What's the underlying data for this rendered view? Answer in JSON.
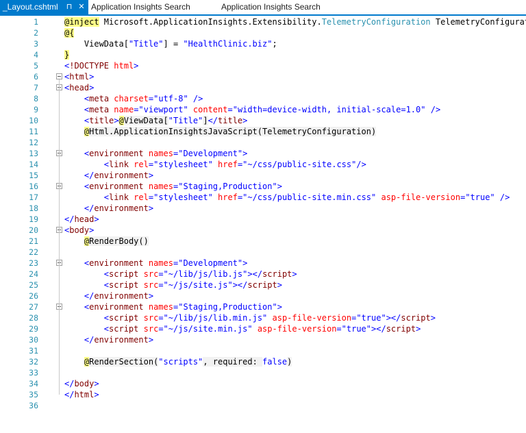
{
  "tabs": [
    {
      "label": "_Layout.cshtml",
      "active": true,
      "pin_glyph": "⊓",
      "close_glyph": "✕"
    },
    {
      "label": "Application Insights Search",
      "active": false
    },
    {
      "label": "Application Insights Search",
      "active": false
    }
  ],
  "colors": {
    "accent": "#007acc",
    "line_number": "#2b91af",
    "html_tag": "#800000",
    "html_attr": "#ff0000",
    "html_value": "#0000ff",
    "razor_highlight": "#ffff88"
  },
  "lines": [
    {
      "n": "1",
      "fold": false,
      "t": [
        [
          "razor",
          "@inject"
        ],
        [
          "txt",
          " Microsoft.ApplicationInsights.Extensibility."
        ],
        [
          "type",
          "TelemetryConfiguration"
        ],
        [
          "txt",
          " TelemetryConfiguration"
        ]
      ]
    },
    {
      "n": "2",
      "fold": false,
      "t": [
        [
          "razor",
          "@{"
        ]
      ]
    },
    {
      "n": "3",
      "fold": false,
      "t": [
        [
          "txt",
          "    ViewData["
        ],
        [
          "str",
          "\"Title\""
        ],
        [
          "txt",
          "] = "
        ],
        [
          "str",
          "\"HealthClinic.biz\""
        ],
        [
          "txt",
          ";"
        ]
      ]
    },
    {
      "n": "4",
      "fold": false,
      "t": [
        [
          "razor",
          "}"
        ]
      ]
    },
    {
      "n": "5",
      "fold": false,
      "t": [
        [
          "del",
          "<"
        ],
        [
          "tag",
          "!DOCTYPE"
        ],
        [
          "txt",
          " "
        ],
        [
          "attr",
          "html"
        ],
        [
          "del",
          ">"
        ]
      ]
    },
    {
      "n": "6",
      "fold": true,
      "t": [
        [
          "del",
          "<"
        ],
        [
          "tag",
          "html"
        ],
        [
          "del",
          ">"
        ]
      ]
    },
    {
      "n": "7",
      "fold": true,
      "t": [
        [
          "del",
          "<"
        ],
        [
          "tag",
          "head"
        ],
        [
          "del",
          ">"
        ]
      ]
    },
    {
      "n": "8",
      "fold": false,
      "t": [
        [
          "txt",
          "    "
        ],
        [
          "del",
          "<"
        ],
        [
          "tag",
          "meta"
        ],
        [
          "txt",
          " "
        ],
        [
          "attr",
          "charset"
        ],
        [
          "del",
          "="
        ],
        [
          "str",
          "\"utf-8\""
        ],
        [
          "txt",
          " "
        ],
        [
          "del",
          "/>"
        ]
      ]
    },
    {
      "n": "9",
      "fold": false,
      "t": [
        [
          "txt",
          "    "
        ],
        [
          "del",
          "<"
        ],
        [
          "tag",
          "meta"
        ],
        [
          "txt",
          " "
        ],
        [
          "attr",
          "name"
        ],
        [
          "del",
          "="
        ],
        [
          "str",
          "\"viewport\""
        ],
        [
          "txt",
          " "
        ],
        [
          "attr",
          "content"
        ],
        [
          "del",
          "="
        ],
        [
          "str",
          "\"width=device-width, initial-scale=1.0\""
        ],
        [
          "txt",
          " "
        ],
        [
          "del",
          "/>"
        ]
      ]
    },
    {
      "n": "10",
      "fold": false,
      "t": [
        [
          "txt",
          "    "
        ],
        [
          "del",
          "<"
        ],
        [
          "tag",
          "title"
        ],
        [
          "del",
          ">"
        ],
        [
          "razor",
          "@"
        ],
        [
          "raz-body",
          "ViewData["
        ],
        [
          "str",
          "\"Title\""
        ],
        [
          "raz-body",
          "]"
        ],
        [
          "del",
          "</"
        ],
        [
          "tag",
          "title"
        ],
        [
          "del",
          ">"
        ]
      ]
    },
    {
      "n": "11",
      "fold": false,
      "t": [
        [
          "txt",
          "    "
        ],
        [
          "razor",
          "@"
        ],
        [
          "raz-body",
          "Html.ApplicationInsightsJavaScript(TelemetryConfiguration)"
        ]
      ]
    },
    {
      "n": "12",
      "fold": false,
      "t": []
    },
    {
      "n": "13",
      "fold": true,
      "t": [
        [
          "txt",
          "    "
        ],
        [
          "del",
          "<"
        ],
        [
          "tag",
          "environment"
        ],
        [
          "txt",
          " "
        ],
        [
          "attr",
          "names"
        ],
        [
          "del",
          "="
        ],
        [
          "str",
          "\"Development\""
        ],
        [
          "del",
          ">"
        ]
      ]
    },
    {
      "n": "14",
      "fold": false,
      "t": [
        [
          "txt",
          "        "
        ],
        [
          "del",
          "<"
        ],
        [
          "tag",
          "link"
        ],
        [
          "txt",
          " "
        ],
        [
          "attr",
          "rel"
        ],
        [
          "del",
          "="
        ],
        [
          "str",
          "\"stylesheet\""
        ],
        [
          "txt",
          " "
        ],
        [
          "attr",
          "href"
        ],
        [
          "del",
          "="
        ],
        [
          "str",
          "\"~/css/public-site.css\""
        ],
        [
          "del",
          "/>"
        ]
      ]
    },
    {
      "n": "15",
      "fold": false,
      "t": [
        [
          "txt",
          "    "
        ],
        [
          "del",
          "</"
        ],
        [
          "tag",
          "environment"
        ],
        [
          "del",
          ">"
        ]
      ]
    },
    {
      "n": "16",
      "fold": true,
      "t": [
        [
          "txt",
          "    "
        ],
        [
          "del",
          "<"
        ],
        [
          "tag",
          "environment"
        ],
        [
          "txt",
          " "
        ],
        [
          "attr",
          "names"
        ],
        [
          "del",
          "="
        ],
        [
          "str",
          "\"Staging,Production\""
        ],
        [
          "del",
          ">"
        ]
      ]
    },
    {
      "n": "17",
      "fold": false,
      "t": [
        [
          "txt",
          "        "
        ],
        [
          "del",
          "<"
        ],
        [
          "tag",
          "link"
        ],
        [
          "txt",
          " "
        ],
        [
          "attr",
          "rel"
        ],
        [
          "del",
          "="
        ],
        [
          "str",
          "\"stylesheet\""
        ],
        [
          "txt",
          " "
        ],
        [
          "attr",
          "href"
        ],
        [
          "del",
          "="
        ],
        [
          "str",
          "\"~/css/public-site.min.css\""
        ],
        [
          "txt",
          " "
        ],
        [
          "attr",
          "asp-file-version"
        ],
        [
          "del",
          "="
        ],
        [
          "str",
          "\"true\""
        ],
        [
          "txt",
          " "
        ],
        [
          "del",
          "/>"
        ]
      ]
    },
    {
      "n": "18",
      "fold": false,
      "t": [
        [
          "txt",
          "    "
        ],
        [
          "del",
          "</"
        ],
        [
          "tag",
          "environment"
        ],
        [
          "del",
          ">"
        ]
      ]
    },
    {
      "n": "19",
      "fold": false,
      "t": [
        [
          "del",
          "</"
        ],
        [
          "tag",
          "head"
        ],
        [
          "del",
          ">"
        ]
      ]
    },
    {
      "n": "20",
      "fold": true,
      "t": [
        [
          "del",
          "<"
        ],
        [
          "tag",
          "body"
        ],
        [
          "del",
          ">"
        ]
      ]
    },
    {
      "n": "21",
      "fold": false,
      "t": [
        [
          "txt",
          "    "
        ],
        [
          "razor",
          "@"
        ],
        [
          "raz-body",
          "RenderBody()"
        ]
      ]
    },
    {
      "n": "22",
      "fold": false,
      "t": []
    },
    {
      "n": "23",
      "fold": true,
      "t": [
        [
          "txt",
          "    "
        ],
        [
          "del",
          "<"
        ],
        [
          "tag",
          "environment"
        ],
        [
          "txt",
          " "
        ],
        [
          "attr",
          "names"
        ],
        [
          "del",
          "="
        ],
        [
          "str",
          "\"Development\""
        ],
        [
          "del",
          ">"
        ]
      ]
    },
    {
      "n": "24",
      "fold": false,
      "t": [
        [
          "txt",
          "        "
        ],
        [
          "del",
          "<"
        ],
        [
          "tag",
          "script"
        ],
        [
          "txt",
          " "
        ],
        [
          "attr",
          "src"
        ],
        [
          "del",
          "="
        ],
        [
          "str",
          "\"~/lib/js/lib.js\""
        ],
        [
          "del",
          "></"
        ],
        [
          "tag",
          "script"
        ],
        [
          "del",
          ">"
        ]
      ]
    },
    {
      "n": "25",
      "fold": false,
      "t": [
        [
          "txt",
          "        "
        ],
        [
          "del",
          "<"
        ],
        [
          "tag",
          "script"
        ],
        [
          "txt",
          " "
        ],
        [
          "attr",
          "src"
        ],
        [
          "del",
          "="
        ],
        [
          "str",
          "\"~/js/site.js\""
        ],
        [
          "del",
          "></"
        ],
        [
          "tag",
          "script"
        ],
        [
          "del",
          ">"
        ]
      ]
    },
    {
      "n": "26",
      "fold": false,
      "t": [
        [
          "txt",
          "    "
        ],
        [
          "del",
          "</"
        ],
        [
          "tag",
          "environment"
        ],
        [
          "del",
          ">"
        ]
      ]
    },
    {
      "n": "27",
      "fold": true,
      "t": [
        [
          "txt",
          "    "
        ],
        [
          "del",
          "<"
        ],
        [
          "tag",
          "environment"
        ],
        [
          "txt",
          " "
        ],
        [
          "attr",
          "names"
        ],
        [
          "del",
          "="
        ],
        [
          "str",
          "\"Staging,Production\""
        ],
        [
          "del",
          ">"
        ]
      ]
    },
    {
      "n": "28",
      "fold": false,
      "t": [
        [
          "txt",
          "        "
        ],
        [
          "del",
          "<"
        ],
        [
          "tag",
          "script"
        ],
        [
          "txt",
          " "
        ],
        [
          "attr",
          "src"
        ],
        [
          "del",
          "="
        ],
        [
          "str",
          "\"~/lib/js/lib.min.js\""
        ],
        [
          "txt",
          " "
        ],
        [
          "attr",
          "asp-file-version"
        ],
        [
          "del",
          "="
        ],
        [
          "str",
          "\"true\""
        ],
        [
          "del",
          "></"
        ],
        [
          "tag",
          "script"
        ],
        [
          "del",
          ">"
        ]
      ]
    },
    {
      "n": "29",
      "fold": false,
      "t": [
        [
          "txt",
          "        "
        ],
        [
          "del",
          "<"
        ],
        [
          "tag",
          "script"
        ],
        [
          "txt",
          " "
        ],
        [
          "attr",
          "src"
        ],
        [
          "del",
          "="
        ],
        [
          "str",
          "\"~/js/site.min.js\""
        ],
        [
          "txt",
          " "
        ],
        [
          "attr",
          "asp-file-version"
        ],
        [
          "del",
          "="
        ],
        [
          "str",
          "\"true\""
        ],
        [
          "del",
          "></"
        ],
        [
          "tag",
          "script"
        ],
        [
          "del",
          ">"
        ]
      ]
    },
    {
      "n": "30",
      "fold": false,
      "t": [
        [
          "txt",
          "    "
        ],
        [
          "del",
          "</"
        ],
        [
          "tag",
          "environment"
        ],
        [
          "del",
          ">"
        ]
      ]
    },
    {
      "n": "31",
      "fold": false,
      "t": []
    },
    {
      "n": "32",
      "fold": false,
      "t": [
        [
          "txt",
          "    "
        ],
        [
          "razor",
          "@"
        ],
        [
          "raz-body",
          "RenderSection("
        ],
        [
          "str",
          "\"scripts\""
        ],
        [
          "raz-body",
          ", required: "
        ],
        [
          "kw",
          "false"
        ],
        [
          "raz-body",
          ")"
        ]
      ]
    },
    {
      "n": "33",
      "fold": false,
      "t": []
    },
    {
      "n": "34",
      "fold": false,
      "t": [
        [
          "del",
          "</"
        ],
        [
          "tag",
          "body"
        ],
        [
          "del",
          ">"
        ]
      ]
    },
    {
      "n": "35",
      "fold": false,
      "t": [
        [
          "del",
          "</"
        ],
        [
          "tag",
          "html"
        ],
        [
          "del",
          ">"
        ]
      ]
    },
    {
      "n": "36",
      "fold": false,
      "t": []
    }
  ]
}
